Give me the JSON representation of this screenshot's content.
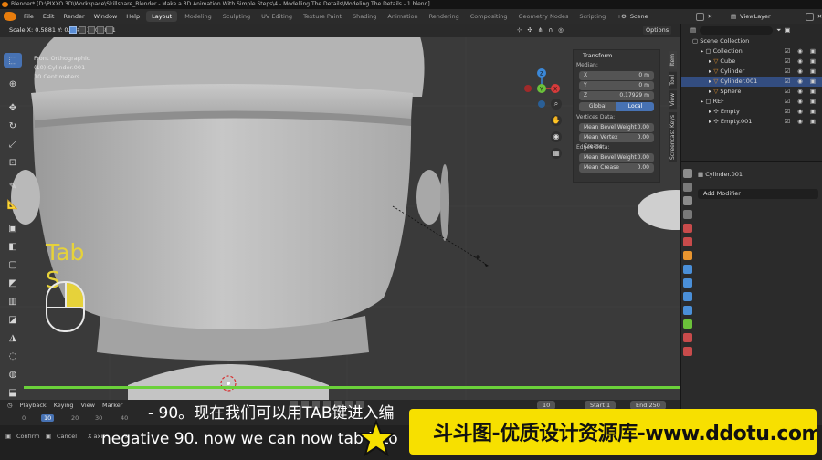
{
  "window": {
    "title": "Blender* [D:\\PIXXO 3D\\Workspace\\Skillshare_Blender - Make a 3D Animation With Simple Steps\\4 - Modelling The Details\\Modeling The Details - 1.blend]"
  },
  "menu": [
    "File",
    "Edit",
    "Render",
    "Window",
    "Help"
  ],
  "workspaces": [
    "Layout",
    "Modeling",
    "Sculpting",
    "UV Editing",
    "Texture Paint",
    "Shading",
    "Animation",
    "Rendering",
    "Compositing",
    "Geometry Nodes",
    "Scripting"
  ],
  "active_workspace": "Layout",
  "scene": "Scene",
  "view_layer": "ViewLayer",
  "viewport": {
    "header_text": "Scale X: 0.5881  Y: 0.5881  Z: 0.5881",
    "options_label": "Options",
    "view_name": "Front Orthographic",
    "object_info": "(10) Cylinder.001",
    "scale_info": "10 Centimeters",
    "key_overlay_1": "Tab",
    "key_overlay_2": "S"
  },
  "gizmo": {
    "x": "X",
    "y": "Y",
    "z": "Z"
  },
  "npanel": {
    "header": "Transform",
    "median_label": "Median:",
    "x_label": "X",
    "x_value": "0 m",
    "y_label": "Y",
    "y_value": "0 m",
    "z_label": "Z",
    "z_value": "0.17929 m",
    "global_label": "Global",
    "local_label": "Local",
    "vertices_data": "Vertices Data:",
    "mean_bevel_weight_v": "Mean Bevel Weight",
    "mean_bevel_weight_v_value": "0.00",
    "mean_vertex_crease": "Mean Vertex Crease",
    "mean_vertex_crease_value": "0.00",
    "edges_data": "Edges Data:",
    "mean_bevel_weight_e": "Mean Bevel Weight",
    "mean_bevel_weight_e_value": "0.00",
    "mean_crease": "Mean Crease",
    "mean_crease_value": "0.00",
    "tabs": [
      "Item",
      "Tool",
      "View",
      "Screencast Keys"
    ]
  },
  "timeline": {
    "menus": [
      "Playback",
      "Keying",
      "View",
      "Marker"
    ],
    "current_frame": "10",
    "start_label": "Start",
    "start_value": "1",
    "end_label": "End",
    "end_value": "250",
    "frame_value": "10",
    "ruler": [
      "0",
      "10",
      "20",
      "30",
      "40"
    ]
  },
  "status": {
    "confirm": "Confirm",
    "cancel": "Cancel",
    "x_axis": "X axis",
    "y_axis": "Y"
  },
  "outliner": {
    "title": "Scene Collection",
    "rows": [
      {
        "name": "Collection",
        "indent": 1
      },
      {
        "name": "Cube",
        "indent": 2
      },
      {
        "name": "Cylinder",
        "indent": 2
      },
      {
        "name": "Cylinder.001",
        "indent": 2,
        "selected": true
      },
      {
        "name": "Sphere",
        "indent": 2
      },
      {
        "name": "REF",
        "indent": 1
      },
      {
        "name": "Empty",
        "indent": 2
      },
      {
        "name": "Empty.001",
        "indent": 2
      }
    ]
  },
  "properties": {
    "object_name": "Cylinder.001",
    "add_modifier": "Add Modifier"
  },
  "subtitles": {
    "chinese": "- 90。现在我们可以用TAB键进入编",
    "english": "negative 90. now we can now tab into"
  },
  "watermark": {
    "text": "斗斗图-优质设计资源库-www.ddotu.com"
  },
  "colors": {
    "accent_blue": "#4772b3",
    "selected_row": "#334d80",
    "key_overlay_yellow": "#e6d23a",
    "timeline_green": "#6bd13a",
    "banner_yellow": "#f7e000",
    "viewport_bg": "#3a3a3a"
  }
}
